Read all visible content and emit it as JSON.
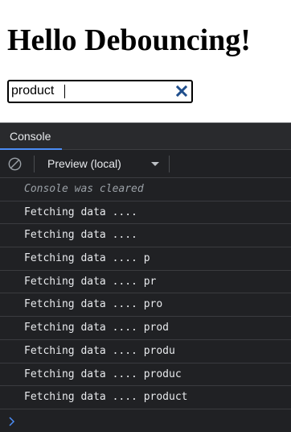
{
  "page": {
    "heading": "Hello Debouncing!",
    "search": {
      "value": "product"
    }
  },
  "devtools": {
    "tabs": [
      {
        "label": "Console",
        "active": true
      }
    ],
    "toolbar": {
      "context_label": "Preview (local)"
    },
    "console": {
      "cleared_message": "Console was cleared",
      "logs": [
        "Fetching data ....",
        "Fetching data ....",
        "Fetching data .... p",
        "Fetching data .... pr",
        "Fetching data .... pro",
        "Fetching data .... prod",
        "Fetching data .... produ",
        "Fetching data .... produc",
        "Fetching data .... product"
      ]
    }
  },
  "colors": {
    "accent": "#4c8df6",
    "clear_x": "#1f4e8c",
    "devtools_bg": "#202124",
    "prompt": "#4c8df6"
  },
  "icons": [
    "clear-x-icon",
    "clear-console-icon",
    "dropdown-arrow-icon",
    "prompt-chevron-icon"
  ]
}
